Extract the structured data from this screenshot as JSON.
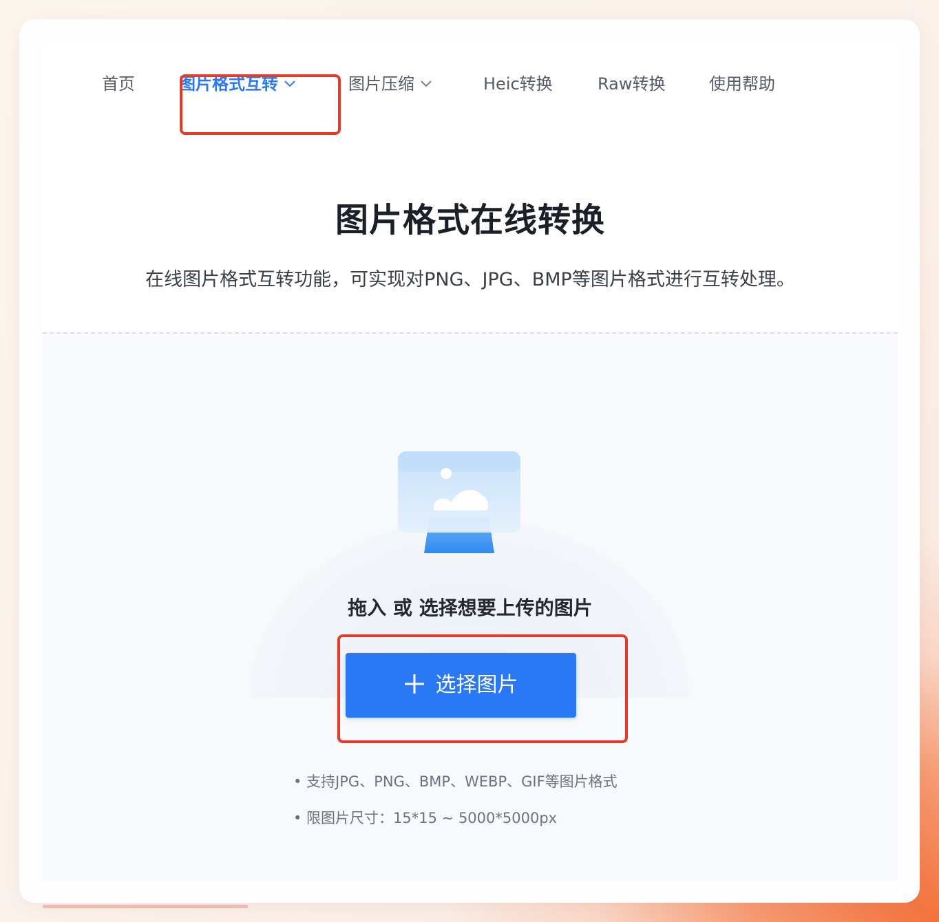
{
  "nav": {
    "items": [
      {
        "label": "首页",
        "icon": null
      },
      {
        "label": "图片格式互转",
        "icon": "chevron-down-icon",
        "active": true
      },
      {
        "label": "图片压缩",
        "icon": "chevron-down-icon"
      },
      {
        "label": "Heic转换",
        "icon": null
      },
      {
        "label": "Raw转换",
        "icon": null
      },
      {
        "label": "使用帮助",
        "icon": null
      }
    ]
  },
  "hero": {
    "title": "图片格式在线转换",
    "description": "在线图片格式互转功能，可实现对PNG、JPG、BMP等图片格式进行互转处理。"
  },
  "upload": {
    "illustration_icon": "monitor-image-icon",
    "hint": "拖入 或 选择想要上传的图片",
    "button_label": "选择图片",
    "button_icon": "plus-icon",
    "info": [
      "• 支持JPG、PNG、BMP、WEBP、GIF等图片格式",
      "• 限图片尺寸：15*15 ~ 5000*5000px"
    ]
  },
  "colors": {
    "accent": "#2b79f2",
    "button": "#2b78f5",
    "highlight": "#e8382a"
  }
}
